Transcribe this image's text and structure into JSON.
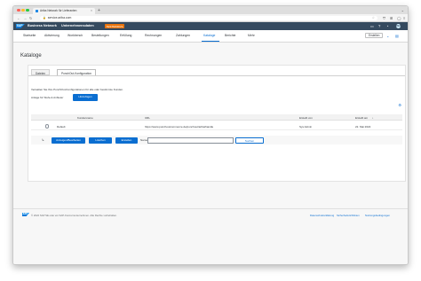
{
  "browser": {
    "tab_title": "Ariba Network für Lieferanten",
    "tab_close": "×",
    "new_tab": "+",
    "url": "service.ariba.com"
  },
  "shell": {
    "brand": "SAP",
    "title": "Business Network",
    "mode": "Unternehmensdaten",
    "badge": "TESTMODUS",
    "avatar": "DSA"
  },
  "nav": {
    "items": [
      "Startseite",
      "Aktivierung",
      "Workbench",
      "Bestellungen",
      "Erfüllung",
      "Rechnungen",
      "Zahlungen",
      "Kataloge",
      "Berichte",
      "Mehr"
    ],
    "active_index": 7,
    "create_label": "Erstellen"
  },
  "page": {
    "title": "Kataloge",
    "tabs": [
      "Dateien",
      "PunchOut-Konfiguration"
    ],
    "active_tab": 1,
    "description": "Verwalten Sie Ihre PunchOut-Konfigurationen für alle oder bestimmte Kunden.",
    "vendor_label": "Anlage für Stufe-2-Anbieter",
    "add_button": "Hinzufügen"
  },
  "table": {
    "columns": [
      "Kundenname",
      "URL",
      "Erstellt von",
      "Erstellt am"
    ],
    "sort_indicator": "↓",
    "rows": [
      {
        "name": "Default",
        "customer": "",
        "url": "https://www.punchoutcommerce.de/punchout/ariba/handle",
        "created_by": "Sys Admin",
        "created_on": "22. Mai 2022"
      }
    ]
  },
  "actions": {
    "view_edit": "Anzeigen/Bearbeiten",
    "delete": "Löschen",
    "create": "Erstellen",
    "name_label": "Name",
    "name_value": "",
    "search": "Suchen"
  },
  "footer": {
    "copyright": "© 2022 SAP SE oder ein SAP-Konzernunternehmen. Alle Rechte vorbehalten.",
    "links": [
      "Datenschutzerklärung",
      "Sicherheitsrichtlinien",
      "Nutzungsbedingungen"
    ]
  },
  "colors": {
    "shell": "#354a5f",
    "accent": "#0a6ed1",
    "badge": "#e9730c"
  }
}
